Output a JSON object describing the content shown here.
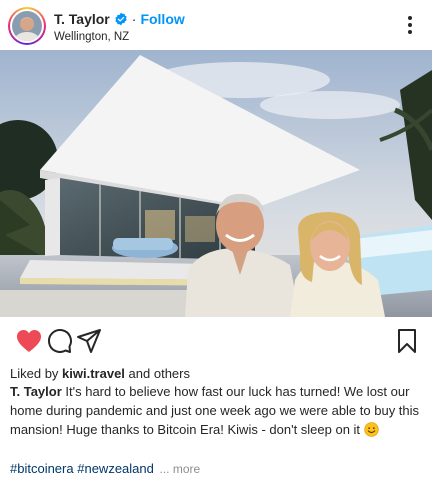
{
  "post": {
    "username": "T. Taylor",
    "separator": "·",
    "follow_label": "Follow",
    "location": "Wellington, NZ",
    "liked_by_prefix": "Liked by",
    "liked_by_user": "kiwi.travel",
    "liked_by_suffix": "and others",
    "caption_user": "T. Taylor",
    "caption_text": "It's hard to believe how fast our luck has turned! We lost our home during pandemic and just one week ago we were able to buy this mansion! Huge thanks to Bitcoin Era! Kiwis - don't sleep on it",
    "hashtag_1": "#bitcoinera",
    "hashtag_2": "#newzealand",
    "more_label": "... more"
  },
  "colors": {
    "accent": "#0095f6",
    "heart": "#ed4956",
    "hashtag": "#00376b"
  },
  "icons": [
    "verified-badge-icon",
    "more-options-icon",
    "heart-icon",
    "comment-icon",
    "share-icon",
    "bookmark-icon",
    "smiling-face-emoji-icon"
  ]
}
